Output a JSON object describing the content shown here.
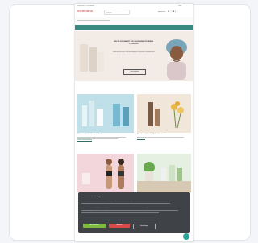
{
  "util_bar": {
    "left_text": "Lieferung 2-3 Werktage",
    "right_text": "Hilfe"
  },
  "header": {
    "logo": "medinaria",
    "search_placeholder": "Suchen",
    "icons": [
      "user-icon",
      "heart-icon",
      "cart-icon"
    ],
    "account_label": "Anmelden",
    "cart_count": "0"
  },
  "nav": {
    "items": [
      "Neu",
      "Marken",
      "Gesicht",
      "Körper",
      "Haare",
      "Parfum",
      "Gesundheit",
      "Sale"
    ]
  },
  "hero": {
    "title": "BIS ZU 20% RABATT AUF AUSGEWÄHLTE DERMA-PRODUKTE",
    "text": "Entdecken Sie unsere exklusiven Angebote für gesunde, strahlende Haut.",
    "button": "Jetzt entdecken"
  },
  "tiles": [
    {
      "caption": "Sonnenschutz für die ganze Familie",
      "link": "Zu den Sonnenprodukten"
    },
    {
      "caption": "Naturkosmetik für Ihr Wohlbefinden",
      "link": "Mehr erfahren"
    },
    {
      "caption": "Bademode & Pflege",
      "link": "Jetzt shoppen"
    },
    {
      "caption": "Nachhaltige Pflege für Zuhause",
      "link": "Entdecken"
    }
  ],
  "cookie": {
    "title": "Datenschutzeinstellungen",
    "text1": "Wir verwenden Cookies, um Ihnen die bestmögliche Nutzung unserer Website zu ermöglichen.",
    "text2": "Sie können Ihre Einstellungen jederzeit anpassen. Weitere Informationen finden Sie in unserer Datenschutzerklärung.",
    "accept": "Alle akzeptieren",
    "reject": "Ablehnen",
    "settings": "Einstellungen"
  },
  "colors": {
    "brand": "#3b8a82",
    "accept": "#7dbb3f",
    "reject": "#d94a4a",
    "logo": "#d87b7b"
  }
}
